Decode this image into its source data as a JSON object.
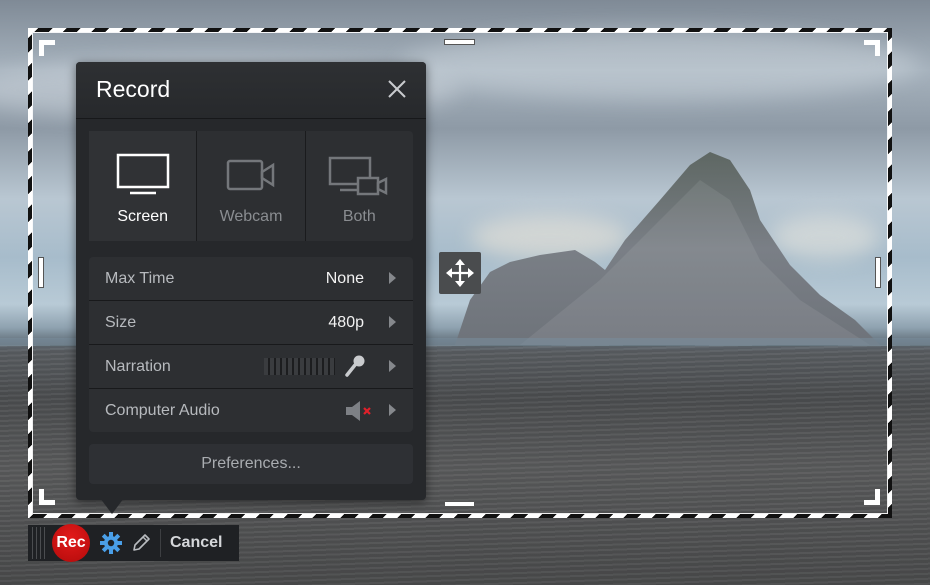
{
  "panel": {
    "title": "Record",
    "close_icon": "close-icon",
    "modes": [
      {
        "label": "Screen",
        "icon": "monitor-icon",
        "active": true
      },
      {
        "label": "Webcam",
        "icon": "webcam-icon",
        "active": false
      },
      {
        "label": "Both",
        "icon": "monitor-webcam-icon",
        "active": false
      }
    ],
    "settings": [
      {
        "label": "Max Time",
        "value": "None"
      },
      {
        "label": "Size",
        "value": "480p"
      },
      {
        "label": "Narration",
        "value": "",
        "icon": "microphone-icon"
      },
      {
        "label": "Computer Audio",
        "value": "",
        "icon": "speaker-muted-icon"
      }
    ],
    "preferences_label": "Preferences..."
  },
  "toolbar": {
    "rec_label": "Rec",
    "cancel_label": "Cancel",
    "settings_icon": "gear-icon",
    "draw_icon": "pencil-icon"
  },
  "colors": {
    "rec": "#d11313",
    "gear": "#4a9fe8",
    "muted_x": "#e0202a"
  }
}
